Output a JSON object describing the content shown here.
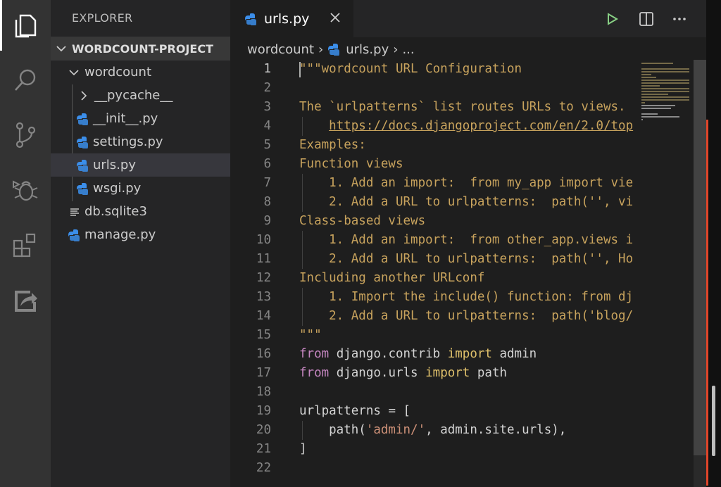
{
  "activity_bar": {
    "items": [
      {
        "name": "explorer",
        "icon": "files-icon",
        "active": true
      },
      {
        "name": "search",
        "icon": "search-icon"
      },
      {
        "name": "source-control",
        "icon": "source-control-icon"
      },
      {
        "name": "debug",
        "icon": "debug-icon"
      },
      {
        "name": "extensions",
        "icon": "extensions-icon"
      },
      {
        "name": "remote",
        "icon": "remote-explorer-icon"
      }
    ]
  },
  "sidebar": {
    "title": "EXPLORER",
    "section": "WORDCOUNT-PROJECT",
    "tree": [
      {
        "label": "wordcount",
        "type": "folder-open"
      },
      {
        "label": "__pycache__",
        "type": "folder-closed"
      },
      {
        "label": "__init__.py",
        "type": "python"
      },
      {
        "label": "settings.py",
        "type": "python"
      },
      {
        "label": "urls.py",
        "type": "python",
        "selected": true
      },
      {
        "label": "wsgi.py",
        "type": "python"
      },
      {
        "label": "db.sqlite3",
        "type": "file"
      },
      {
        "label": "manage.py",
        "type": "python"
      }
    ]
  },
  "editor": {
    "tab": {
      "label": "urls.py"
    },
    "actions": [
      "run-icon",
      "split-editor-icon",
      "more-icon"
    ],
    "breadcrumb": {
      "folder": "wordcount",
      "file": "urls.py",
      "rest": "..."
    },
    "lines": [
      {
        "n": "1",
        "segs": [
          [
            "doc",
            "\"\"\"wordcount URL Configuration"
          ]
        ]
      },
      {
        "n": "2",
        "segs": []
      },
      {
        "n": "3",
        "segs": [
          [
            "doc",
            "The `urlpatterns` list routes URLs to views. "
          ]
        ]
      },
      {
        "n": "4",
        "segs": [
          [
            "doc",
            "    "
          ],
          [
            "link",
            "https://docs.djangoproject.com/en/2.0/top"
          ]
        ]
      },
      {
        "n": "5",
        "segs": [
          [
            "doc",
            "Examples:"
          ]
        ]
      },
      {
        "n": "6",
        "segs": [
          [
            "doc",
            "Function views"
          ]
        ]
      },
      {
        "n": "7",
        "segs": [
          [
            "doc",
            "    1. Add an import:  from my_app import vie"
          ]
        ]
      },
      {
        "n": "8",
        "segs": [
          [
            "doc",
            "    2. Add a URL to urlpatterns:  path('', vi"
          ]
        ]
      },
      {
        "n": "9",
        "segs": [
          [
            "doc",
            "Class-based views"
          ]
        ]
      },
      {
        "n": "10",
        "segs": [
          [
            "doc",
            "    1. Add an import:  from other_app.views i"
          ]
        ]
      },
      {
        "n": "11",
        "segs": [
          [
            "doc",
            "    2. Add a URL to urlpatterns:  path('', Ho"
          ]
        ]
      },
      {
        "n": "12",
        "segs": [
          [
            "doc",
            "Including another URLconf"
          ]
        ]
      },
      {
        "n": "13",
        "segs": [
          [
            "doc",
            "    1. Import the include() function: from dj"
          ]
        ]
      },
      {
        "n": "14",
        "segs": [
          [
            "doc",
            "    2. Add a URL to urlpatterns:  path('blog/"
          ]
        ]
      },
      {
        "n": "15",
        "segs": [
          [
            "doc",
            "\"\"\""
          ]
        ]
      },
      {
        "n": "16",
        "segs": [
          [
            "kw",
            "from"
          ],
          [
            "plain",
            " django.contrib "
          ],
          [
            "imp",
            "import"
          ],
          [
            "plain",
            " admin"
          ]
        ]
      },
      {
        "n": "17",
        "segs": [
          [
            "kw",
            "from"
          ],
          [
            "plain",
            " django.urls "
          ],
          [
            "imp",
            "import"
          ],
          [
            "plain",
            " path"
          ]
        ]
      },
      {
        "n": "18",
        "segs": []
      },
      {
        "n": "19",
        "segs": [
          [
            "plain",
            "urlpatterns "
          ],
          [
            "op",
            "="
          ],
          [
            "plain",
            " ["
          ]
        ]
      },
      {
        "n": "20",
        "segs": [
          [
            "plain",
            "    path("
          ],
          [
            "str",
            "'admin/'"
          ],
          [
            "plain",
            ", admin.site.urls),"
          ]
        ]
      },
      {
        "n": "21",
        "segs": [
          [
            "plain",
            "]"
          ]
        ]
      },
      {
        "n": "22",
        "segs": []
      }
    ]
  },
  "colors": {
    "activity_bg": "#333333",
    "sidebar_bg": "#252526",
    "editor_bg": "#1e1e1e",
    "python_icon": "#3b8eea",
    "run_icon": "#89d185"
  }
}
